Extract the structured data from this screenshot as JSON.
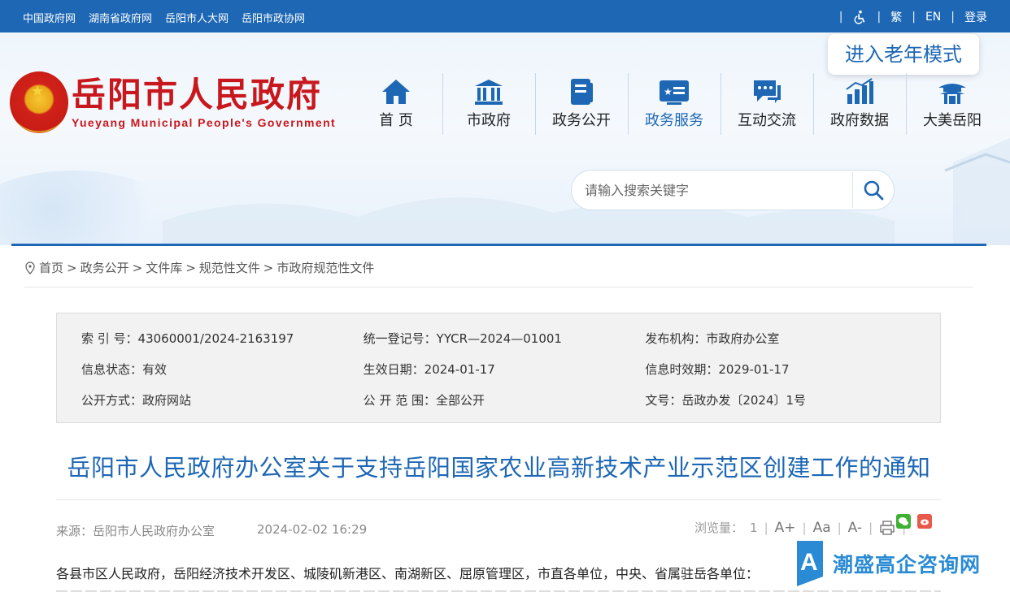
{
  "topbar": {
    "links": [
      "中国政府网",
      "湖南省政府网",
      "岳阳市人大网",
      "岳阳市政协网"
    ],
    "accessibility_icon": "wheelchair-icon",
    "traditional": "繁",
    "english": "EN",
    "login": "登录"
  },
  "header": {
    "logo_cn": "岳阳市人民政府",
    "logo_en": "Yueyang Municipal People's Government",
    "elder_mode": "进入老年模式",
    "nav": [
      {
        "label": "首 页",
        "icon": "home-icon"
      },
      {
        "label": "市政府",
        "icon": "government-building-icon"
      },
      {
        "label": "政务公开",
        "icon": "document-icon"
      },
      {
        "label": "政务服务",
        "icon": "service-card-icon",
        "active": true
      },
      {
        "label": "互动交流",
        "icon": "chat-icon"
      },
      {
        "label": "政府数据",
        "icon": "data-chart-icon"
      },
      {
        "label": "大美岳阳",
        "icon": "pavilion-icon"
      }
    ],
    "search_placeholder": "请输入搜索关键字"
  },
  "breadcrumb": [
    "首页",
    "政务公开",
    "文件库",
    "规范性文件",
    "市政府规范性文件"
  ],
  "meta": {
    "index_no": "索 引 号：43060001/2024-2163197",
    "reg_no": "统一登记号：YYCR—2024—01001",
    "publisher": "发布机构：市政府办公室",
    "status": "信息状态：有效",
    "effective_date": "生效日期：2024-01-17",
    "expiry_date": "信息时效期：2029-01-17",
    "disclosure_method": "公开方式：政府网站",
    "disclosure_scope": "公 开 范 围：全部公开",
    "doc_no": "文号：岳政办发〔2024〕1号"
  },
  "article": {
    "title": "岳阳市人民政府办公室关于支持岳阳国家农业高新技术产业示范区创建工作的通知",
    "source": "来源：岳阳市人民政府办公室",
    "date": "2024-02-02 16:29",
    "views_label": "浏览量：",
    "views": "1",
    "font_larger": "A+",
    "font_normal": "Aa",
    "font_smaller": "A-",
    "salutation": "各县市区人民政府，岳阳经济技术开发区、城陵矶新港区、南湖新区、屈原管理区，市直各单位，中央、省属驻岳各单位："
  },
  "watermark": "潮盛高企咨询网",
  "colors": {
    "primary": "#1d67b5",
    "logo_red": "#c8171d",
    "meta_bg": "#f2f2f2"
  }
}
